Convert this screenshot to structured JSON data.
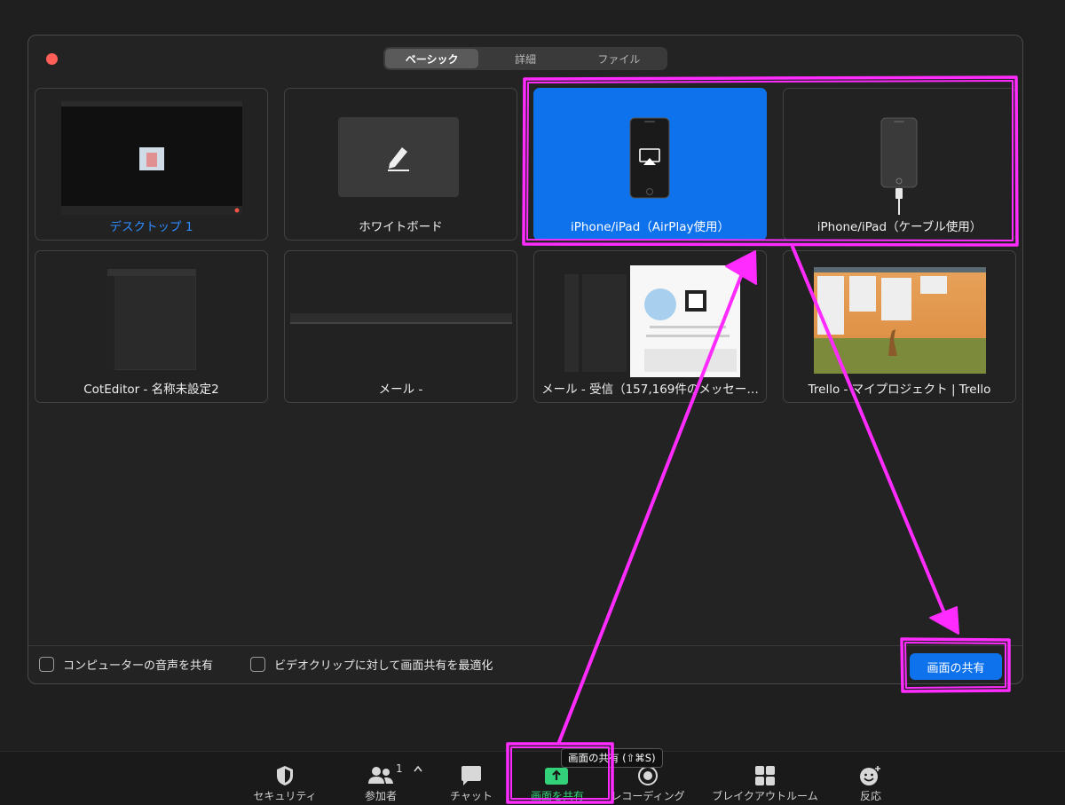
{
  "tabs": [
    {
      "label": "ベーシック",
      "active": true
    },
    {
      "label": "詳細",
      "active": false
    },
    {
      "label": "ファイル",
      "active": false
    }
  ],
  "tiles": [
    {
      "label": "デスクトップ 1",
      "selected": false
    },
    {
      "label": "ホワイトボード",
      "selected": false
    },
    {
      "label": "iPhone/iPad（AirPlay使用）",
      "selected": true
    },
    {
      "label": "iPhone/iPad（ケーブル使用）",
      "selected": false
    },
    {
      "label": "CotEditor - 名称未設定2",
      "selected": false
    },
    {
      "label": "メール -",
      "selected": false
    },
    {
      "label": "メール - 受信（157,169件のメッセー…",
      "selected": false
    },
    {
      "label": "Trello - マイプロジェクト | Trello",
      "selected": false
    }
  ],
  "options": {
    "share_audio": {
      "label": "コンピューターの音声を共有",
      "checked": false
    },
    "optimize_video": {
      "label": "ビデオクリップに対して画面共有を最適化",
      "checked": false
    }
  },
  "share_button_label": "画面の共有",
  "toolbar": {
    "security": "セキュリティ",
    "participants": "参加者",
    "participants_count": "1",
    "chat": "チャット",
    "share_screen": "画面を共有",
    "recording": "レコーディング",
    "breakout": "ブレイクアウトルーム",
    "reactions": "反応"
  },
  "tooltip": "画面の共有 (⇧⌘S)",
  "colors": {
    "accent": "#0e72ed",
    "annotation": "#ff2bff",
    "share_green": "#33d17a"
  }
}
